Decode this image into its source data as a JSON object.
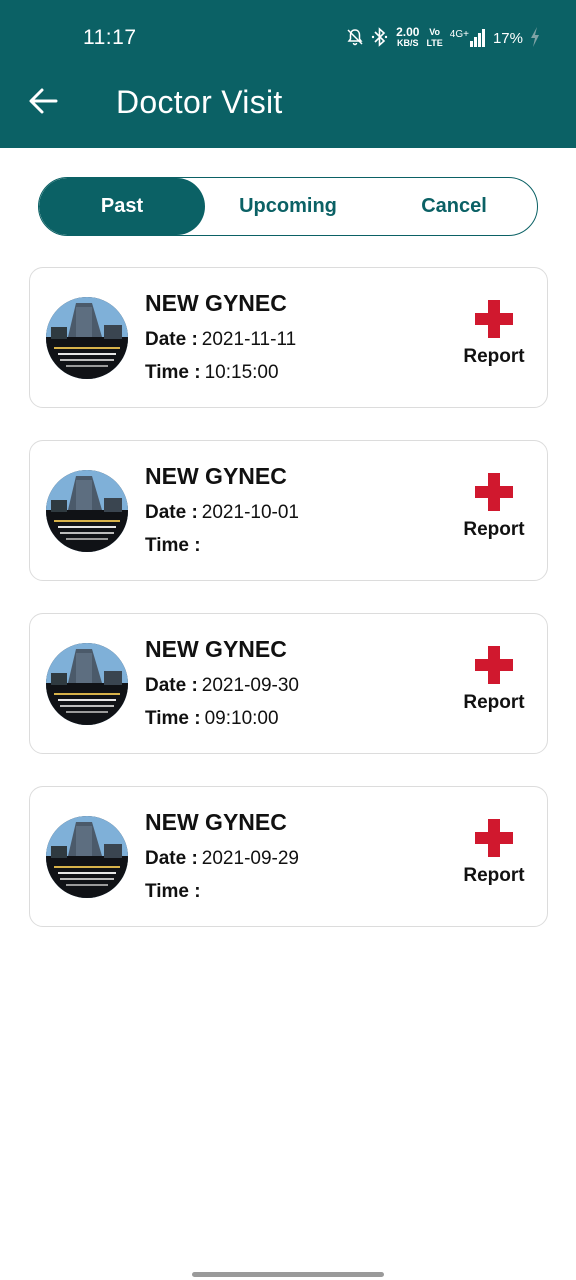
{
  "status_bar": {
    "time": "11:17",
    "net_speed": "2.00",
    "net_unit": "KB/S",
    "volte_top": "Vo",
    "volte_bottom": "LTE",
    "signal_label": "4G+",
    "battery": "17%"
  },
  "header": {
    "title": "Doctor Visit",
    "back_icon": "arrow-left-icon"
  },
  "tabs": [
    {
      "label": "Past",
      "active": true
    },
    {
      "label": "Upcoming",
      "active": false
    },
    {
      "label": "Cancel",
      "active": false
    }
  ],
  "labels": {
    "date": "Date :",
    "time": "Time :",
    "report": "Report"
  },
  "visits": [
    {
      "name": "NEW GYNEC",
      "date": "2021-11-11",
      "time": "10:15:00"
    },
    {
      "name": "NEW GYNEC",
      "date": "2021-10-01",
      "time": ""
    },
    {
      "name": "NEW GYNEC",
      "date": "2021-09-30",
      "time": "09:10:00"
    },
    {
      "name": "NEW GYNEC",
      "date": "2021-09-29",
      "time": ""
    }
  ],
  "colors": {
    "primary": "#0b6165",
    "report_cross": "#d0182e"
  }
}
